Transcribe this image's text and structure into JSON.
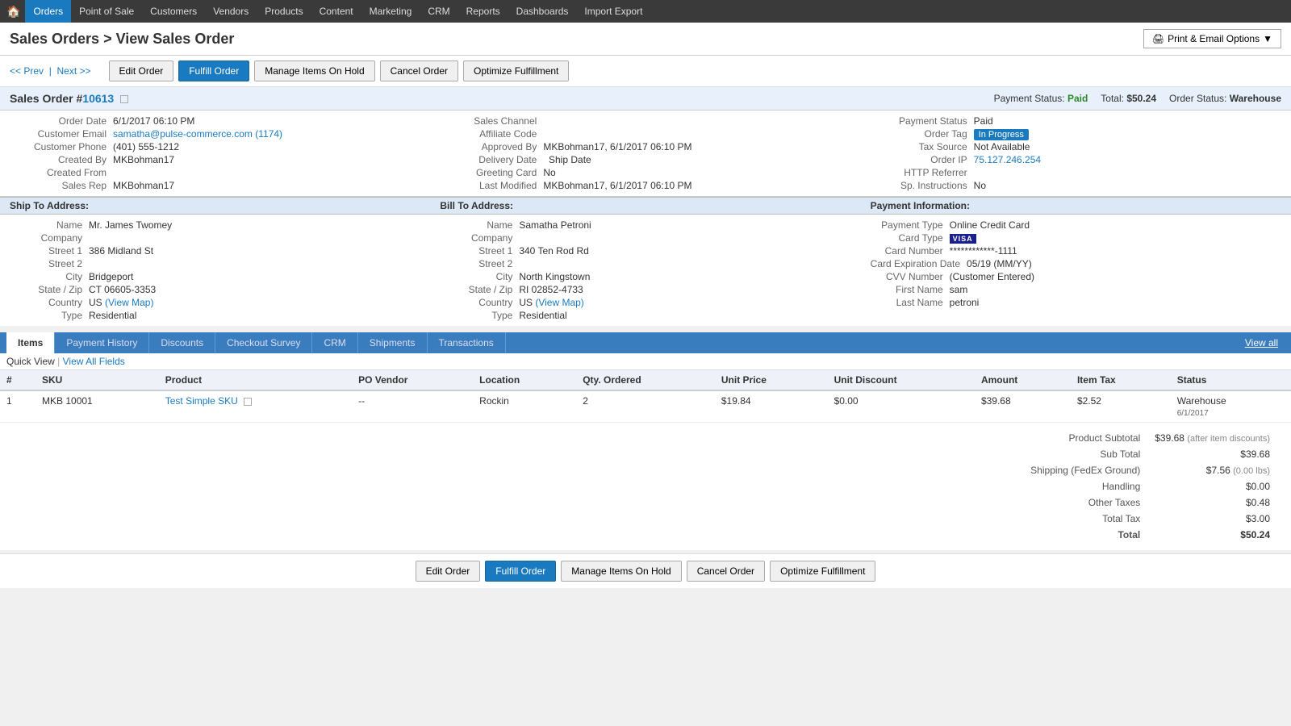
{
  "nav": {
    "home_icon": "🏠",
    "items": [
      {
        "label": "Orders",
        "active": true
      },
      {
        "label": "Point of Sale",
        "active": false
      },
      {
        "label": "Customers",
        "active": false
      },
      {
        "label": "Vendors",
        "active": false
      },
      {
        "label": "Products",
        "active": false
      },
      {
        "label": "Content",
        "active": false
      },
      {
        "label": "Marketing",
        "active": false
      },
      {
        "label": "CRM",
        "active": false
      },
      {
        "label": "Reports",
        "active": false
      },
      {
        "label": "Dashboards",
        "active": false
      },
      {
        "label": "Import Export",
        "active": false
      }
    ]
  },
  "page": {
    "title": "Sales Orders > View Sales Order",
    "prev_link": "<< Prev",
    "next_link": "Next >>",
    "print_btn": "Print & Email Options"
  },
  "buttons": {
    "edit_order": "Edit Order",
    "fulfill_order": "Fulfill Order",
    "manage_hold": "Manage Items On Hold",
    "cancel_order": "Cancel Order",
    "optimize": "Optimize Fulfillment"
  },
  "order": {
    "label": "Sales Order #",
    "number": "10613",
    "payment_status_label": "Payment Status:",
    "payment_status_value": "Paid",
    "total_label": "Total:",
    "total_value": "$50.24",
    "order_status_label": "Order Status:",
    "order_status_value": "Warehouse"
  },
  "order_details": {
    "order_date_label": "Order Date",
    "order_date_value": "6/1/2017 06:10 PM",
    "customer_email_label": "Customer Email",
    "customer_email_value": "samatha@pulse-commerce.com",
    "customer_email_link": "(1174)",
    "customer_phone_label": "Customer Phone",
    "customer_phone_value": "(401) 555-1212",
    "created_by_label": "Created By",
    "created_by_value": "MKBohman17",
    "created_from_label": "Created From",
    "created_from_value": "",
    "sales_rep_label": "Sales Rep",
    "sales_rep_value": "MKBohman17",
    "sales_channel_label": "Sales Channel",
    "sales_channel_value": "",
    "affiliate_code_label": "Affiliate Code",
    "affiliate_code_value": "",
    "approved_by_label": "Approved By",
    "approved_by_value": "MKBohman17, 6/1/2017 06:10 PM",
    "delivery_date_label": "Delivery Date",
    "delivery_date_value": "",
    "ship_date_label": "Ship Date",
    "ship_date_value": "",
    "greeting_card_label": "Greeting Card",
    "greeting_card_value": "No",
    "last_modified_label": "Last Modified",
    "last_modified_value": "MKBohman17, 6/1/2017 06:10 PM",
    "payment_status_label": "Payment Status",
    "payment_status_value": "Paid",
    "order_tag_label": "Order Tag",
    "order_tag_value": "In Progress",
    "tax_source_label": "Tax Source",
    "tax_source_value": "Not Available",
    "order_ip_label": "Order IP",
    "order_ip_value": "75.127.246.254",
    "http_referrer_label": "HTTP Referrer",
    "http_referrer_value": "",
    "sp_instructions_label": "Sp. Instructions",
    "sp_instructions_value": "No"
  },
  "ship_to": {
    "header": "Ship To Address:",
    "name_label": "Name",
    "name_value": "Mr. James Twomey",
    "company_label": "Company",
    "company_value": "",
    "street1_label": "Street 1",
    "street1_value": "386 Midland St",
    "street2_label": "Street 2",
    "street2_value": "",
    "city_label": "City",
    "city_value": "Bridgeport",
    "state_zip_label": "State / Zip",
    "state_zip_value": "CT 06605-3353",
    "country_label": "Country",
    "country_value": "US",
    "country_link": "(View Map)",
    "type_label": "Type",
    "type_value": "Residential"
  },
  "bill_to": {
    "header": "Bill To Address:",
    "name_label": "Name",
    "name_value": "Samatha Petroni",
    "company_label": "Company",
    "company_value": "",
    "street1_label": "Street 1",
    "street1_value": "340 Ten Rod Rd",
    "street2_label": "Street 2",
    "street2_value": "",
    "city_label": "City",
    "city_value": "North Kingstown",
    "state_zip_label": "State / Zip",
    "state_zip_value": "RI 02852-4733",
    "country_label": "Country",
    "country_value": "US",
    "country_link": "(View Map)",
    "type_label": "Type",
    "type_value": "Residential"
  },
  "payment_info": {
    "header": "Payment Information:",
    "payment_type_label": "Payment Type",
    "payment_type_value": "Online Credit Card",
    "card_type_label": "Card Type",
    "card_type_value": "VISA",
    "card_number_label": "Card Number",
    "card_number_value": "************-1111",
    "card_expiration_label": "Card Expiration Date",
    "card_expiration_value": "05/19 (MM/YY)",
    "cvv_label": "CVV Number",
    "cvv_value": "(Customer Entered)",
    "first_name_label": "First Name",
    "first_name_value": "sam",
    "last_name_label": "Last Name",
    "last_name_value": "petroni"
  },
  "tabs": [
    {
      "label": "Items",
      "active": true
    },
    {
      "label": "Payment History",
      "active": false
    },
    {
      "label": "Discounts",
      "active": false
    },
    {
      "label": "Checkout Survey",
      "active": false
    },
    {
      "label": "CRM",
      "active": false
    },
    {
      "label": "Shipments",
      "active": false
    },
    {
      "label": "Transactions",
      "active": false
    }
  ],
  "view_all": "View all",
  "quick_view_label": "Quick View",
  "view_all_fields_label": "View All Fields",
  "table_headers": {
    "num": "#",
    "sku": "SKU",
    "product": "Product",
    "po_vendor": "PO Vendor",
    "location": "Location",
    "qty_ordered": "Qty. Ordered",
    "unit_price": "Unit Price",
    "unit_discount": "Unit Discount",
    "amount": "Amount",
    "item_tax": "Item Tax",
    "status": "Status"
  },
  "items": [
    {
      "num": "1",
      "sku": "MKB 10001",
      "product": "Test Simple SKU",
      "po_vendor": "--",
      "location": "Rockin",
      "qty_ordered": "2",
      "unit_price": "$19.84",
      "unit_discount": "$0.00",
      "amount": "$39.68",
      "item_tax": "$2.52",
      "status": "Warehouse",
      "status_date": "6/1/2017"
    }
  ],
  "totals": {
    "product_subtotal_label": "Product Subtotal",
    "product_subtotal_value": "$39.68",
    "product_subtotal_note": "(after item discounts)",
    "sub_total_label": "Sub Total",
    "sub_total_value": "$39.68",
    "shipping_label": "Shipping (FedEx Ground)",
    "shipping_value": "$7.56",
    "shipping_note": "(0.00 lbs)",
    "handling_label": "Handling",
    "handling_value": "$0.00",
    "other_taxes_label": "Other Taxes",
    "other_taxes_value": "$0.48",
    "total_tax_label": "Total Tax",
    "total_tax_value": "$3.00",
    "total_label": "Total",
    "total_value": "$50.24"
  }
}
